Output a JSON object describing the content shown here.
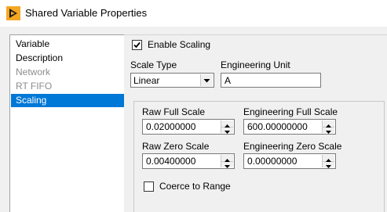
{
  "window": {
    "title": "Shared Variable Properties",
    "accent": "#f5a623"
  },
  "categories": [
    {
      "label": "Variable",
      "state": "normal"
    },
    {
      "label": "Description",
      "state": "normal"
    },
    {
      "label": "Network",
      "state": "disabled"
    },
    {
      "label": "RT FIFO",
      "state": "disabled"
    },
    {
      "label": "Scaling",
      "state": "selected"
    }
  ],
  "scaling": {
    "enable_label": "Enable Scaling",
    "enable_checked": true,
    "scale_type_label": "Scale Type",
    "scale_type_value": "Linear",
    "engineering_unit_label": "Engineering Unit",
    "engineering_unit_value": "A",
    "raw_full_scale_label": "Raw Full Scale",
    "raw_full_scale_value": "0.02000000",
    "engineering_full_scale_label": "Engineering Full Scale",
    "engineering_full_scale_value": "600.00000000",
    "raw_zero_scale_label": "Raw Zero Scale",
    "raw_zero_scale_value": "0.00400000",
    "engineering_zero_scale_label": "Engineering Zero Scale",
    "engineering_zero_scale_value": "0.00000000",
    "coerce_label": "Coerce to Range",
    "coerce_checked": false
  },
  "colors": {
    "selection": "#0078d7",
    "disabled_text": "#8c8c8c"
  }
}
